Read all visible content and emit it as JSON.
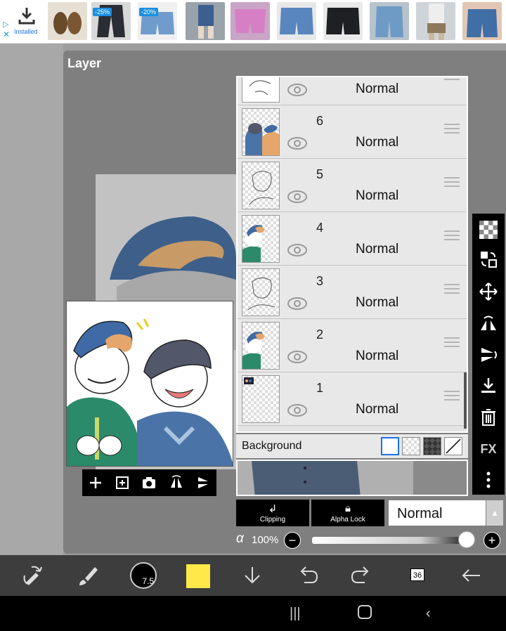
{
  "ad": {
    "install_label": "Installed",
    "adchoice_icon": "adchoices-triangle-icon",
    "close_icon": "close-icon",
    "badges": [
      "-25%",
      "-20%"
    ]
  },
  "panel": {
    "title": "Layer"
  },
  "layers": [
    {
      "number": "",
      "mode": "Normal"
    },
    {
      "number": "6",
      "mode": "Normal"
    },
    {
      "number": "5",
      "mode": "Normal"
    },
    {
      "number": "4",
      "mode": "Normal"
    },
    {
      "number": "3",
      "mode": "Normal"
    },
    {
      "number": "2",
      "mode": "Normal"
    },
    {
      "number": "1",
      "mode": "Normal"
    }
  ],
  "background": {
    "label": "Background"
  },
  "layer_controls": {
    "clipping_label": "Clipping",
    "alpha_lock_label": "Alpha Lock",
    "blend_mode": "Normal"
  },
  "opacity": {
    "symbol": "α",
    "value": "100%",
    "level": 1.0
  },
  "toolbar": {
    "brush_size": "7.5",
    "color": "#ffe84a",
    "layer_count": "36"
  },
  "colors": {
    "panel_bg": "#7f7f7f",
    "accent_blue": "#1a73e8"
  }
}
